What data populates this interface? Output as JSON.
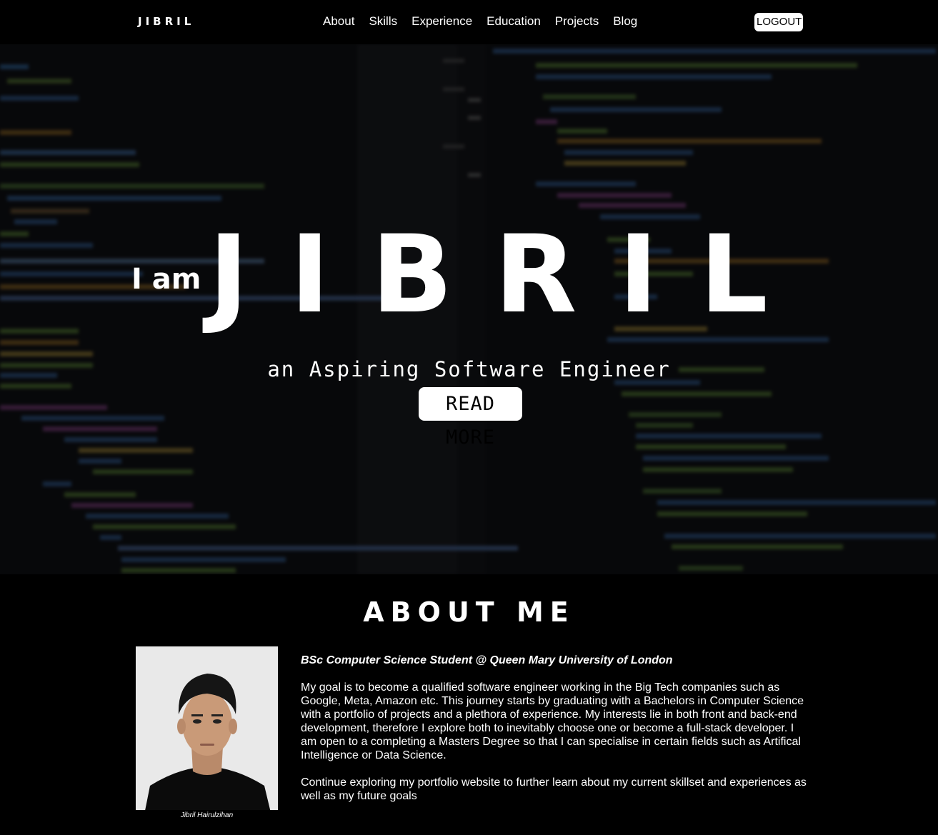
{
  "navbar": {
    "brand": "JIBRIL",
    "links": [
      "About",
      "Skills",
      "Experience",
      "Education",
      "Projects",
      "Blog"
    ],
    "logout_label": "LOGOUT"
  },
  "hero": {
    "prefix": "I am",
    "name": "JIBRIL",
    "subtitle": "an Aspiring Software Engineer",
    "read_more_label": "READ MORE"
  },
  "about": {
    "title": "ABOUT ME",
    "photo_caption": "Jibril Hairulzihan",
    "headline": "BSc Computer Science Student @ Queen Mary University of London",
    "paragraph_1": "My goal is to become a qualified software engineer working in the Big Tech companies such as Google, Meta, Amazon etc. This journey starts by graduating with a Bachelors in Computer Science with a portfolio of projects and a plethora of experience. My interests lie in both front and back-end development, therefore I explore both to inevitably choose one or become a full-stack developer. I am open to a completing a Masters Degree so that I can specialise in certain fields such as Artifical Intelligence or Data Science.",
    "paragraph_2": "Continue exploring my portfolio website to further learn about my current skillset and experiences as well as my future goals"
  },
  "colors": {
    "background": "#000000",
    "text": "#ffffff",
    "button_bg": "#ffffff",
    "button_text": "#000000"
  }
}
